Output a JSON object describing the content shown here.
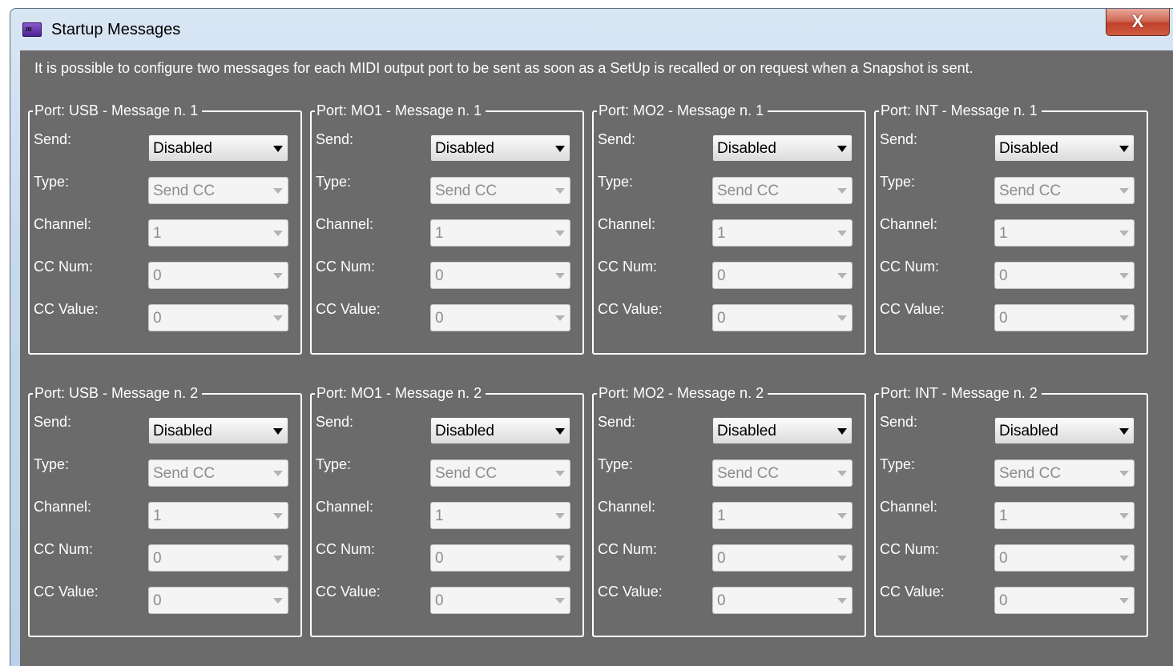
{
  "window": {
    "title": "Startup Messages",
    "close_label": "X"
  },
  "description": "It is possible to configure two messages for each MIDI output port to be sent as soon as a SetUp is recalled or on request when a Snapshot is sent.",
  "field_labels": {
    "send": "Send:",
    "type": "Type:",
    "channel": "Channel:",
    "cc_num": "CC Num:",
    "cc_value": "CC Value:"
  },
  "groups": [
    {
      "legend": "Port: USB - Message n. 1",
      "send": "Disabled",
      "type": "Send CC",
      "channel": "1",
      "cc_num": "0",
      "cc_value": "0"
    },
    {
      "legend": "Port: MO1 - Message n. 1",
      "send": "Disabled",
      "type": "Send CC",
      "channel": "1",
      "cc_num": "0",
      "cc_value": "0"
    },
    {
      "legend": "Port: MO2 - Message n. 1",
      "send": "Disabled",
      "type": "Send CC",
      "channel": "1",
      "cc_num": "0",
      "cc_value": "0"
    },
    {
      "legend": "Port: INT - Message n. 1",
      "send": "Disabled",
      "type": "Send CC",
      "channel": "1",
      "cc_num": "0",
      "cc_value": "0"
    },
    {
      "legend": "Port: USB - Message n. 2",
      "send": "Disabled",
      "type": "Send CC",
      "channel": "1",
      "cc_num": "0",
      "cc_value": "0"
    },
    {
      "legend": "Port: MO1 - Message n. 2",
      "send": "Disabled",
      "type": "Send CC",
      "channel": "1",
      "cc_num": "0",
      "cc_value": "0"
    },
    {
      "legend": "Port: MO2 - Message n. 2",
      "send": "Disabled",
      "type": "Send CC",
      "channel": "1",
      "cc_num": "0",
      "cc_value": "0"
    },
    {
      "legend": "Port: INT - Message n. 2",
      "send": "Disabled",
      "type": "Send CC",
      "channel": "1",
      "cc_num": "0",
      "cc_value": "0"
    }
  ],
  "colors": {
    "client_background": "#6b6b6b",
    "text": "#ffffff",
    "close_button": "#c0412b"
  }
}
